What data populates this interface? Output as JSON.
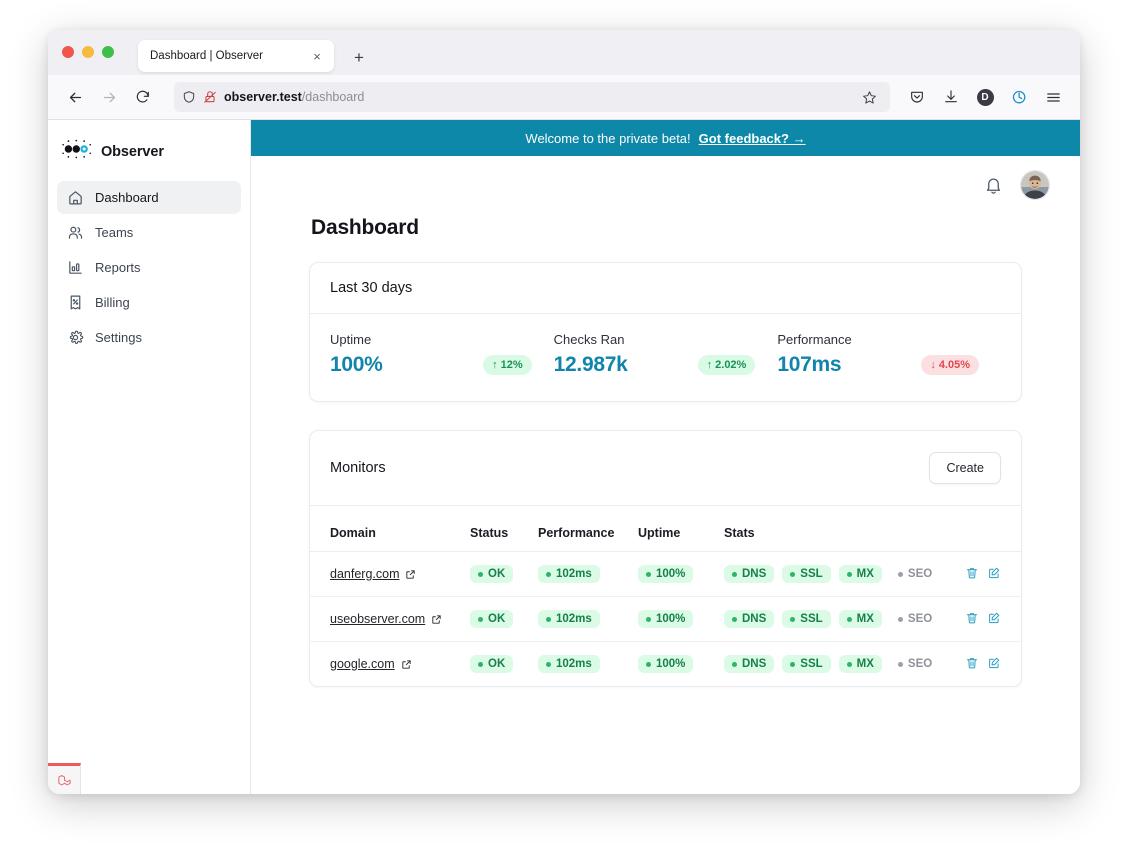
{
  "browser": {
    "tab_title": "Dashboard | Observer",
    "close_tab_label": "×",
    "new_tab_label": "+",
    "url_domain": "observer.test",
    "url_path": "/dashboard",
    "icons": {
      "back": "back-arrow-icon",
      "forward": "forward-arrow-icon",
      "reload": "reload-icon",
      "shield": "shield-icon",
      "lock_crossed": "lock-crossed-out-icon",
      "bookmark_star": "star-icon",
      "pocket": "pocket-icon",
      "downloads": "download-icon",
      "account": "account-icon",
      "account_letter": "D",
      "extension": "extension-icon",
      "menu": "hamburger-menu-icon"
    }
  },
  "sidebar": {
    "brand": "Observer",
    "items": [
      {
        "label": "Dashboard",
        "icon": "home-icon",
        "active": true
      },
      {
        "label": "Teams",
        "icon": "users-icon",
        "active": false
      },
      {
        "label": "Reports",
        "icon": "bar-chart-icon",
        "active": false
      },
      {
        "label": "Billing",
        "icon": "receipt-percent-icon",
        "active": false
      },
      {
        "label": "Settings",
        "icon": "gear-icon",
        "active": false
      }
    ],
    "debugbar_icon": "laravel-debugbar-icon"
  },
  "banner": {
    "message": "Welcome to the private beta!",
    "link": "Got feedback? →"
  },
  "topbar": {
    "bell_icon": "bell-icon",
    "avatar": "user-avatar"
  },
  "page": {
    "title": "Dashboard"
  },
  "stats_card": {
    "title": "Last 30 days",
    "items": [
      {
        "label": "Uptime",
        "value": "100%",
        "delta": "12%",
        "direction": "up",
        "arrow": "↑"
      },
      {
        "label": "Checks Ran",
        "value": "12.987k",
        "delta": "2.02%",
        "direction": "up",
        "arrow": "↑"
      },
      {
        "label": "Performance",
        "value": "107ms",
        "delta": "4.05%",
        "direction": "down",
        "arrow": "↓"
      }
    ]
  },
  "monitors_card": {
    "title": "Monitors",
    "create_label": "Create",
    "columns": [
      "Domain",
      "Status",
      "Performance",
      "Uptime",
      "Stats",
      ""
    ],
    "rows": [
      {
        "domain": "danferg.com",
        "status": "OK",
        "performance": "102ms",
        "uptime": "100%",
        "stats": [
          {
            "label": "DNS",
            "ok": true
          },
          {
            "label": "SSL",
            "ok": true
          },
          {
            "label": "MX",
            "ok": true
          },
          {
            "label": "SEO",
            "ok": false
          }
        ]
      },
      {
        "domain": "useobserver.com",
        "status": "OK",
        "performance": "102ms",
        "uptime": "100%",
        "stats": [
          {
            "label": "DNS",
            "ok": true
          },
          {
            "label": "SSL",
            "ok": true
          },
          {
            "label": "MX",
            "ok": true
          },
          {
            "label": "SEO",
            "ok": false
          }
        ]
      },
      {
        "domain": "google.com",
        "status": "OK",
        "performance": "102ms",
        "uptime": "100%",
        "stats": [
          {
            "label": "DNS",
            "ok": true
          },
          {
            "label": "SSL",
            "ok": true
          },
          {
            "label": "MX",
            "ok": true
          },
          {
            "label": "SEO",
            "ok": false
          }
        ]
      }
    ],
    "row_actions": [
      {
        "icon": "trash-icon",
        "name": "delete-monitor-button"
      },
      {
        "icon": "edit-icon",
        "name": "edit-monitor-button"
      }
    ]
  },
  "colors": {
    "banner": "#0d88a8",
    "accent_value": "#1184ab",
    "badge_bg": "#dcfbe7",
    "badge_text": "#16804a",
    "delta_up_bg": "#d9fbe6",
    "delta_up_text": "#169256",
    "delta_down_bg": "#fcdfe1",
    "delta_down_text": "#e0484f",
    "action_icon": "#2a9ec0"
  }
}
